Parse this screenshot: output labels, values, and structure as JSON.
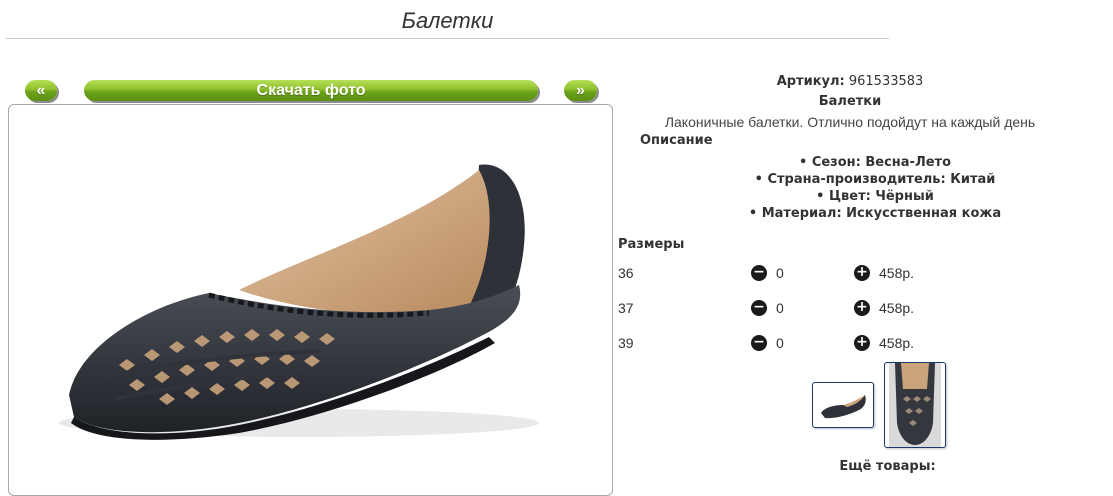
{
  "page": {
    "title": "Балетки"
  },
  "gallery": {
    "prev_label": "«",
    "download_label": "Скачать фото",
    "next_label": "»"
  },
  "product": {
    "article_label": "Артикул:",
    "article_value": "961533583",
    "name": "Балетки",
    "short_description": "Лаконичные балетки. Отлично подойдут на каждый день",
    "description_heading": "Описание",
    "properties": [
      "Сезон: Весна-Лето",
      "Страна-производитель: Китай",
      "Цвет: Чёрный",
      "Материал: Искусственная кожа"
    ]
  },
  "sizes": {
    "heading": "Размеры",
    "rows": [
      {
        "size": "36",
        "qty": "0",
        "price": "458р."
      },
      {
        "size": "37",
        "qty": "0",
        "price": "458р."
      },
      {
        "size": "39",
        "qty": "0",
        "price": "458р."
      }
    ]
  },
  "more_products": {
    "heading": "Ещё товары:"
  },
  "colors": {
    "accent_green": "#7db52a",
    "icon_dark": "#1a1a1a",
    "thumb_border": "#1a3a6a"
  }
}
